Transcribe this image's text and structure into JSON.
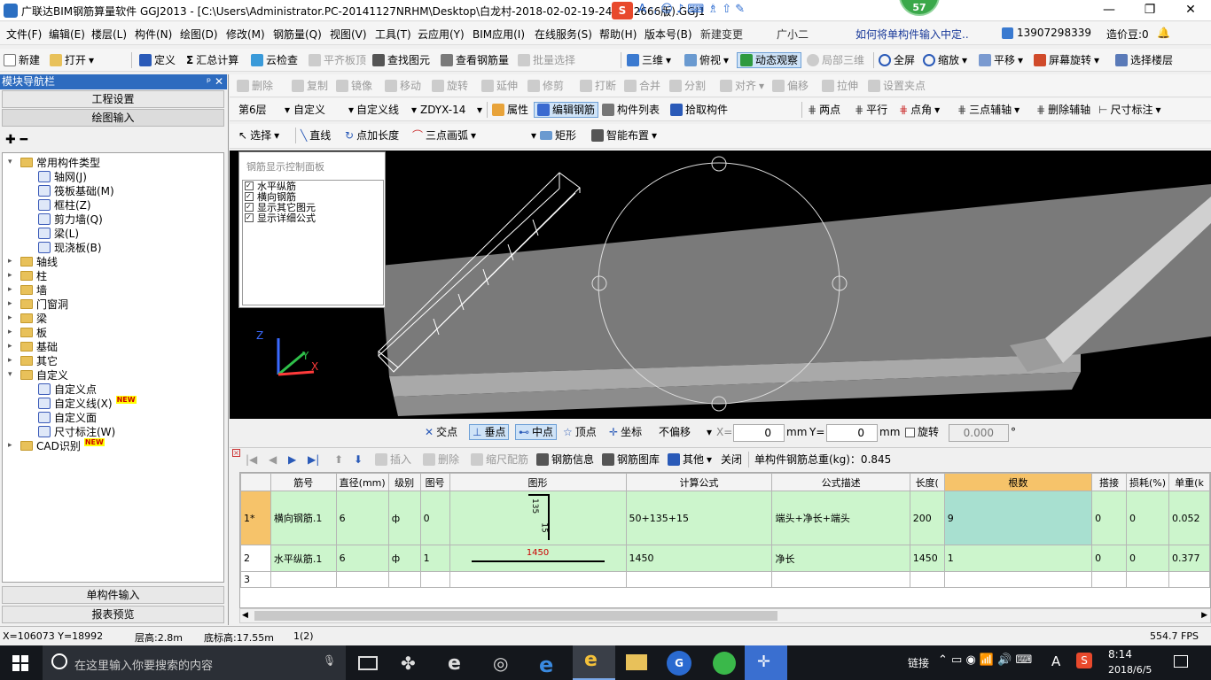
{
  "title": {
    "text": "广联达BIM钢筋算量软件 GGJ2013 - [C:\\Users\\Administrator.PC-20141127NRHM\\Desktop\\白龙村-2018-02-02-19-24-35(2666版).GGJ12]",
    "badge": "57",
    "win_min": "—",
    "win_max": "❐",
    "win_close": "✕"
  },
  "menu": [
    "文件(F)",
    "编辑(E)",
    "楼层(L)",
    "构件(N)",
    "绘图(D)",
    "修改(M)",
    "钢筋量(Q)",
    "视图(V)",
    "工具(T)",
    "云应用(Y)",
    "BIM应用(I)",
    "在线服务(S)",
    "帮助(H)",
    "版本号(B)",
    "新建变更",
    "广小二"
  ],
  "menu_right": {
    "link": "如何将单构件输入中定..",
    "phone": "13907298339",
    "coin": "造价豆:0"
  },
  "toolbar1": {
    "new": "新建",
    "open": "打开",
    "define": "定义",
    "sum": "汇总计算",
    "cloud": "云检查",
    "flat": "平齐板顶",
    "find": "查找图元",
    "view_rebar": "查看钢筋量",
    "batch": "批量选择",
    "three_d": "三维",
    "top": "俯视",
    "dynamic": "动态观察",
    "local3d": "局部三维",
    "full": "全屏",
    "zoom": "缩放",
    "pan": "平移",
    "rotate": "屏幕旋转",
    "select_floor": "选择楼层"
  },
  "toolbar2": {
    "delete": "删除",
    "copy": "复制",
    "mirror": "镜像",
    "move": "移动",
    "rotate": "旋转",
    "extend": "延伸",
    "trim": "修剪",
    "break": "打断",
    "merge": "合并",
    "split": "分割",
    "align": "对齐",
    "offset": "偏移",
    "stretch": "拉伸",
    "setpoint": "设置夹点"
  },
  "toolbar3": {
    "floor": "第6层",
    "type": "自定义",
    "subtype": "自定义线",
    "code": "ZDYX-14",
    "prop": "属性",
    "edit_rebar": "编辑钢筋",
    "list": "构件列表",
    "pick": "拾取构件",
    "twopoint": "两点",
    "parallel": "平行",
    "angle": "点角",
    "threept_aux": "三点辅轴",
    "del_aux": "删除辅轴",
    "dim": "尺寸标注"
  },
  "toolbar4": {
    "select": "选择",
    "line": "直线",
    "ptlen": "点加长度",
    "arc": "三点画弧",
    "rect": "矩形",
    "smart": "智能布置"
  },
  "leftpanel": {
    "header": "模块导航栏",
    "pin": "ᵖ ✕",
    "proj": "工程设置",
    "draw": "绘图输入",
    "single": "单构件输入",
    "report": "报表预览"
  },
  "tree": [
    {
      "label": "常用构件类型",
      "level": 0,
      "exp": "▾",
      "folder": true
    },
    {
      "label": "轴网(J)",
      "level": 1
    },
    {
      "label": "筏板基础(M)",
      "level": 1
    },
    {
      "label": "框柱(Z)",
      "level": 1
    },
    {
      "label": "剪力墙(Q)",
      "level": 1
    },
    {
      "label": "梁(L)",
      "level": 1
    },
    {
      "label": "现浇板(B)",
      "level": 1
    },
    {
      "label": "轴线",
      "level": 0,
      "exp": "▸",
      "folder": true
    },
    {
      "label": "柱",
      "level": 0,
      "exp": "▸",
      "folder": true
    },
    {
      "label": "墙",
      "level": 0,
      "exp": "▸",
      "folder": true
    },
    {
      "label": "门窗洞",
      "level": 0,
      "exp": "▸",
      "folder": true
    },
    {
      "label": "梁",
      "level": 0,
      "exp": "▸",
      "folder": true
    },
    {
      "label": "板",
      "level": 0,
      "exp": "▸",
      "folder": true
    },
    {
      "label": "基础",
      "level": 0,
      "exp": "▸",
      "folder": true
    },
    {
      "label": "其它",
      "level": 0,
      "exp": "▸",
      "folder": true
    },
    {
      "label": "自定义",
      "level": 0,
      "exp": "▾",
      "folder": true
    },
    {
      "label": "自定义点",
      "level": 1
    },
    {
      "label": "自定义线(X)",
      "level": 1,
      "new": "NEW"
    },
    {
      "label": "自定义面",
      "level": 1
    },
    {
      "label": "尺寸标注(W)",
      "level": 1
    },
    {
      "label": "CAD识别",
      "level": 0,
      "exp": "▸",
      "folder": true,
      "new": "NEW"
    }
  ],
  "rebar_panel": {
    "title": "钢筋显示控制面板",
    "items": [
      "水平纵筋",
      "横向钢筋",
      "显示其它图元",
      "显示详细公式"
    ]
  },
  "snap": {
    "cross": "交点",
    "perp": "垂点",
    "mid": "中点",
    "vertex": "顶点",
    "coord": "坐标",
    "nooffset": "不偏移",
    "x_label": "X=",
    "x_val": "0",
    "mm1": "mm",
    "y_label": "Y=",
    "y_val": "0",
    "mm2": "mm",
    "rotate": "旋转",
    "rot_val": "0.000",
    "deg": "°"
  },
  "gridtb": {
    "insert": "插入",
    "delete": "删除",
    "scale": "缩尺配筋",
    "info": "钢筋信息",
    "lib": "钢筋图库",
    "other": "其他",
    "close": "关闭",
    "total": "单构件钢筋总重(kg)：0.845"
  },
  "grid": {
    "headers": [
      "",
      "筋号",
      "直径(mm)",
      "级别",
      "图号",
      "图形",
      "计算公式",
      "公式描述",
      "长度(",
      "根数",
      "搭接",
      "损耗(%)",
      "单重(k"
    ],
    "rows": [
      {
        "no": "1*",
        "name": "横向钢筋.1",
        "dia": "6",
        "grade": "ф",
        "fig": "0",
        "shape_a": "135",
        "shape_b": "15",
        "formula": "50+135+15",
        "desc": "端头+净长+端头",
        "len": "200",
        "count": "9",
        "lap": "0",
        "loss": "0",
        "unit": "0.052"
      },
      {
        "no": "2",
        "name": "水平纵筋.1",
        "dia": "6",
        "grade": "ф",
        "fig": "1",
        "shape_a": "1450",
        "shape_b": "",
        "formula": "1450",
        "desc": "净长",
        "len": "1450",
        "count": "1",
        "lap": "0",
        "loss": "0",
        "unit": "0.377"
      },
      {
        "no": "3",
        "name": "",
        "dia": "",
        "grade": "",
        "fig": "",
        "shape_a": "",
        "shape_b": "",
        "formula": "",
        "desc": "",
        "len": "",
        "count": "",
        "lap": "",
        "loss": "",
        "unit": ""
      }
    ]
  },
  "status": {
    "coord": "X=106073 Y=18992",
    "floor_h": "层高:2.8m",
    "base_h": "底标高:17.55m",
    "page": "1(2)",
    "fps": "554.7 FPS"
  },
  "taskbar": {
    "search": "在这里输入你要搜索的内容",
    "link": "链接",
    "ime": "A",
    "time": "8:14",
    "date": "2018/6/5"
  },
  "colors": {
    "accent": "#2d6bbf",
    "grid_green": "#ccf5cc",
    "count_header": "#f6c36a",
    "canvas": "#000000"
  }
}
